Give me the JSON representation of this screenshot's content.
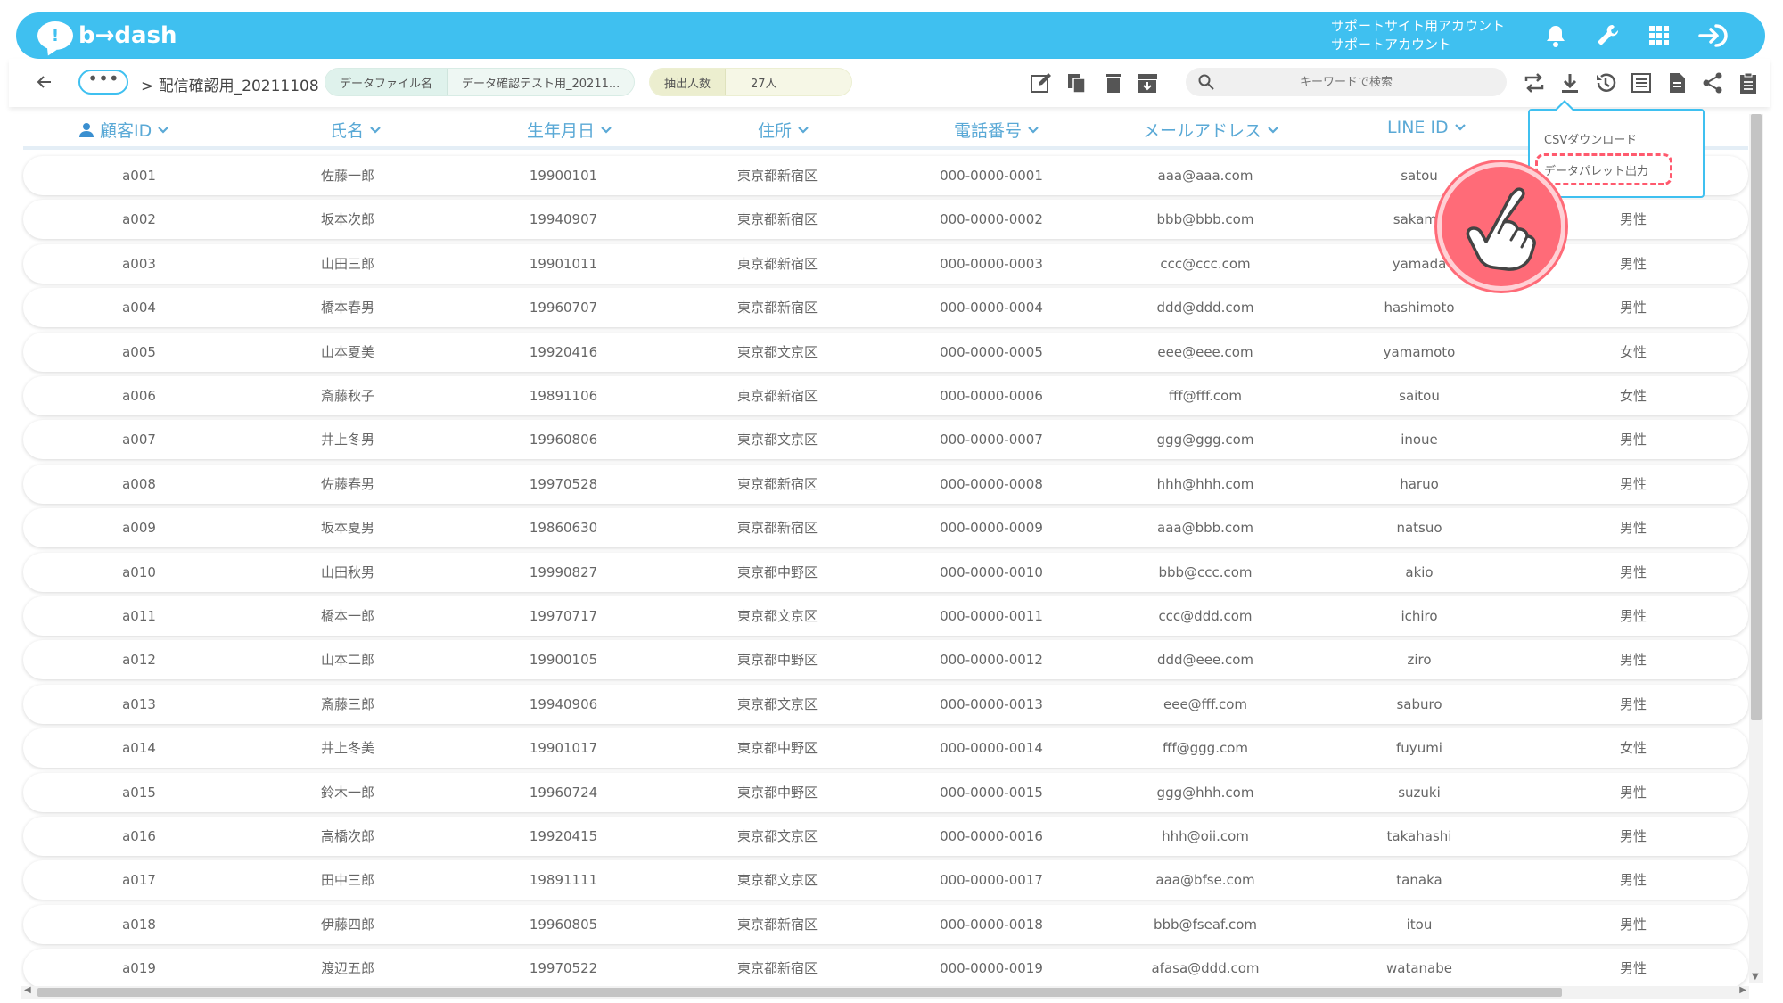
{
  "header": {
    "logo_text": "b→dash",
    "logo_mark": "!",
    "account_line1": "サポートサイト用アカウント",
    "account_line2": "サポートアカウント"
  },
  "toolbar": {
    "more_label": "•••",
    "breadcrumb": "> 配信確認用_20211108",
    "pill1": {
      "label": "データファイル名",
      "value": "データ確認テスト用_20211..."
    },
    "pill2": {
      "label": "抽出人数",
      "value": "27人"
    },
    "search_placeholder": "キーワードで検索"
  },
  "columns": [
    {
      "key": "id",
      "label": "顧客ID"
    },
    {
      "key": "name",
      "label": "氏名"
    },
    {
      "key": "birth",
      "label": "生年月日"
    },
    {
      "key": "address",
      "label": "住所"
    },
    {
      "key": "phone",
      "label": "電話番号"
    },
    {
      "key": "email",
      "label": "メールアドレス"
    },
    {
      "key": "line",
      "label": "LINE ID"
    }
  ],
  "rows": [
    [
      "a001",
      "佐藤一郎",
      "19900101",
      "東京都新宿区",
      "000-0000-0001",
      "aaa@aaa.com",
      "satou",
      ""
    ],
    [
      "a002",
      "坂本次郎",
      "19940907",
      "東京都新宿区",
      "000-0000-0002",
      "bbb@bbb.com",
      "sakamo",
      "男性"
    ],
    [
      "a003",
      "山田三郎",
      "19901011",
      "東京都新宿区",
      "000-0000-0003",
      "ccc@ccc.com",
      "yamada",
      "男性"
    ],
    [
      "a004",
      "橋本春男",
      "19960707",
      "東京都新宿区",
      "000-0000-0004",
      "ddd@ddd.com",
      "hashimoto",
      "男性"
    ],
    [
      "a005",
      "山本夏美",
      "19920416",
      "東京都文京区",
      "000-0000-0005",
      "eee@eee.com",
      "yamamoto",
      "女性"
    ],
    [
      "a006",
      "斎藤秋子",
      "19891106",
      "東京都新宿区",
      "000-0000-0006",
      "fff@fff.com",
      "saitou",
      "女性"
    ],
    [
      "a007",
      "井上冬男",
      "19960806",
      "東京都文京区",
      "000-0000-0007",
      "ggg@ggg.com",
      "inoue",
      "男性"
    ],
    [
      "a008",
      "佐藤春男",
      "19970528",
      "東京都新宿区",
      "000-0000-0008",
      "hhh@hhh.com",
      "haruo",
      "男性"
    ],
    [
      "a009",
      "坂本夏男",
      "19860630",
      "東京都新宿区",
      "000-0000-0009",
      "aaa@bbb.com",
      "natsuo",
      "男性"
    ],
    [
      "a010",
      "山田秋男",
      "19990827",
      "東京都中野区",
      "000-0000-0010",
      "bbb@ccc.com",
      "akio",
      "男性"
    ],
    [
      "a011",
      "橋本一郎",
      "19970717",
      "東京都文京区",
      "000-0000-0011",
      "ccc@ddd.com",
      "ichiro",
      "男性"
    ],
    [
      "a012",
      "山本二郎",
      "19900105",
      "東京都中野区",
      "000-0000-0012",
      "ddd@eee.com",
      "ziro",
      "男性"
    ],
    [
      "a013",
      "斎藤三郎",
      "19940906",
      "東京都文京区",
      "000-0000-0013",
      "eee@fff.com",
      "saburo",
      "男性"
    ],
    [
      "a014",
      "井上冬美",
      "19901017",
      "東京都中野区",
      "000-0000-0014",
      "fff@ggg.com",
      "fuyumi",
      "女性"
    ],
    [
      "a015",
      "鈴木一郎",
      "19960724",
      "東京都中野区",
      "000-0000-0015",
      "ggg@hhh.com",
      "suzuki",
      "男性"
    ],
    [
      "a016",
      "高橋次郎",
      "19920415",
      "東京都文京区",
      "000-0000-0016",
      "hhh@oii.com",
      "takahashi",
      "男性"
    ],
    [
      "a017",
      "田中三郎",
      "19891111",
      "東京都文京区",
      "000-0000-0017",
      "aaa@bfse.com",
      "tanaka",
      "男性"
    ],
    [
      "a018",
      "伊藤四郎",
      "19960805",
      "東京都新宿区",
      "000-0000-0018",
      "bbb@fseaf.com",
      "itou",
      "男性"
    ],
    [
      "a019",
      "渡辺五郎",
      "19970522",
      "東京都新宿区",
      "000-0000-0019",
      "afasa@ddd.com",
      "watanabe",
      "男性"
    ]
  ],
  "dropdown": {
    "items": [
      "CSVダウンロード",
      "データパレット出力"
    ],
    "highlighted": "データパレット出力"
  },
  "colors": {
    "brand": "#3fc0f0",
    "header_text": "#5aa9d6",
    "highlight": "#ff5a6e"
  }
}
